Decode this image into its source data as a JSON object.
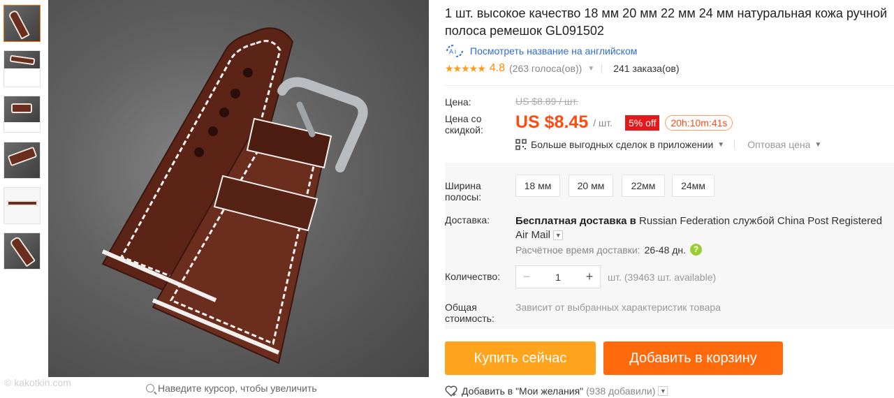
{
  "thumbnails": [
    {
      "name": "thumb-1"
    },
    {
      "name": "thumb-2"
    },
    {
      "name": "thumb-3"
    },
    {
      "name": "thumb-4"
    },
    {
      "name": "thumb-5"
    },
    {
      "name": "thumb-6"
    }
  ],
  "image": {
    "watermark": "© kakotkin.com",
    "zoom_hint": "Наведите курсор, чтобы увеличить"
  },
  "product": {
    "title": "1 шт. высокое качество 18 мм 20 мм 22 мм 24 мм натуральная кожа ручной полоса ремешок GL091502",
    "translate_link": "Посмотреть название на английском",
    "stars": "★★★★★",
    "rating": "4.8",
    "votes": "(263 голоса(ов))",
    "orders": "241 заказа(ов)"
  },
  "price": {
    "label": "Цена:",
    "old": "US $8.89 / шт.",
    "discount_label": "Цена со скидкой:",
    "current": "US $8.45",
    "unit": "/ шт.",
    "discount_badge": "5% off",
    "timer": "20h:10m:41s",
    "app_deals": "Больше выгодных сделок в приложении",
    "wholesale": "Оптовая цена"
  },
  "options": {
    "width_label": "Ширина полосы:",
    "sizes": [
      "18 мм",
      "20 мм",
      "22мм",
      "24мм"
    ]
  },
  "shipping": {
    "label": "Доставка:",
    "free": "Бесплатная доставка в",
    "rest": " Russian Federation службой China Post Registered Air Mail",
    "est_label": "Расчётное время доставки:",
    "est_days": "26-48 дн."
  },
  "quantity": {
    "label": "Количество:",
    "value": "1",
    "note": "шт. (39463 шт. available)"
  },
  "total": {
    "label": "Общая стоимость:",
    "note": "Зависит от выбранных характеристик товара"
  },
  "actions": {
    "buy_now": "Купить сейчас",
    "add_to_cart": "Добавить в корзину",
    "wishlist": "Добавить в \"Мои желания\"",
    "wishlist_count": "(938 добавили)"
  },
  "colors": {
    "accent": "#ff6a00",
    "price": "#ff4b12",
    "buy_button": "#ffa41c",
    "cart_button": "#ff6a0d",
    "link": "#2f6cd6"
  }
}
